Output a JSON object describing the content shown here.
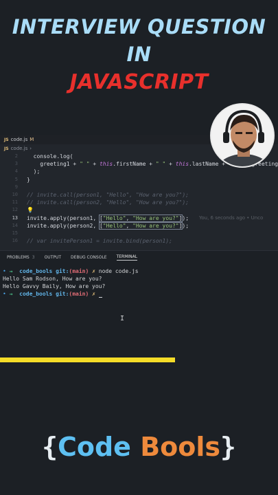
{
  "titles": {
    "line1": "INTERVIEW QUESTION",
    "line2": "IN",
    "line3": "JAVASCRIPT"
  },
  "editor": {
    "tab": {
      "icon": "JS",
      "name": "code.js",
      "status": "M"
    },
    "breadcrumb": {
      "icon": "JS",
      "file": "code.js",
      "sep": "›"
    },
    "lines": [
      {
        "n": "2",
        "text": "  console.log("
      },
      {
        "n": "3",
        "text": "    greeting1 + \" \" + this.firstName + \" \" + this.lastName + \", \" + greeting2"
      },
      {
        "n": "4",
        "text": "  );"
      },
      {
        "n": "5",
        "text": "}"
      },
      {
        "n": "9",
        "text": ""
      },
      {
        "n": "10",
        "text": "// invite.call(person1, \"Hello\", \"How are you?\");"
      },
      {
        "n": "11",
        "text": "// invite.call(person2, \"Hello\", \"How are you?\");"
      },
      {
        "n": "12",
        "text": ""
      },
      {
        "n": "13",
        "text": "invite.apply(person1, [\"Hello\", \"How are you?\"]);"
      },
      {
        "n": "14",
        "text": "invite.apply(person2, [\"Hello\", \"How are you?\"]);"
      },
      {
        "n": "15",
        "text": ""
      },
      {
        "n": "16",
        "text": "// var invitePerson1 = invite.bind(person1);"
      }
    ],
    "blame": "You, 6 seconds ago • Unco"
  },
  "panel": {
    "tabs": [
      {
        "label": "PROBLEMS",
        "count": "3"
      },
      {
        "label": "OUTPUT"
      },
      {
        "label": "DEBUG CONSOLE"
      },
      {
        "label": "TERMINAL"
      }
    ],
    "terminal": {
      "dir": "code_bools",
      "git": "git:",
      "branch": "(main)",
      "x": "✗",
      "command": "node code.js",
      "output1": "Hello Sam Rodson, How are you?",
      "output2": "Hello Gavvy Baily, How are you?"
    }
  },
  "progress": 0.63,
  "brand": {
    "open": "{",
    "word1": "Code",
    "word2": "Bools",
    "close": "}"
  },
  "colors": {
    "background": "#1c2025",
    "title_blue": "#a9dcf7",
    "title_red": "#e8302c",
    "progress_yellow": "#f5dc28",
    "brand_blue": "#5ec0f2",
    "brand_orange": "#ee8a3c"
  }
}
